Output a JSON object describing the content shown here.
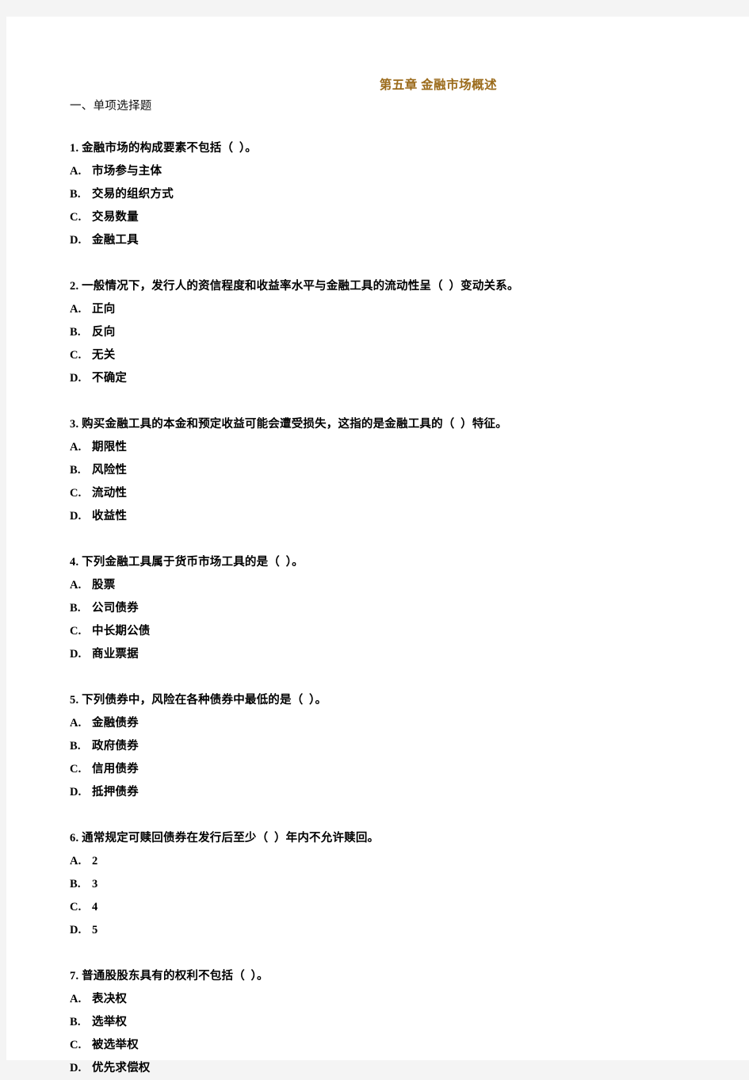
{
  "document": {
    "title": "第五章 金融市场概述",
    "section_heading": "一、单项选择题",
    "title_color": "#9b6b1b",
    "text_color": "#000000",
    "page_background": "#ffffff",
    "canvas_background": "#f4f4f4"
  },
  "questions": [
    {
      "number": "1.",
      "stem": "1. 金融市场的构成要素不包括（  ）。",
      "options": [
        {
          "letter": "A.",
          "text": "市场参与主体"
        },
        {
          "letter": "B.",
          "text": "交易的组织方式"
        },
        {
          "letter": "C.",
          "text": "交易数量"
        },
        {
          "letter": "D.",
          "text": "金融工具"
        }
      ]
    },
    {
      "number": "2.",
      "stem": "2. 一般情况下，发行人的资信程度和收益率水平与金融工具的流动性呈（  ）变动关系。",
      "options": [
        {
          "letter": "A.",
          "text": "正向"
        },
        {
          "letter": "B.",
          "text": "反向"
        },
        {
          "letter": "C.",
          "text": "无关"
        },
        {
          "letter": "D.",
          "text": "不确定"
        }
      ]
    },
    {
      "number": "3.",
      "stem": "3. 购买金融工具的本金和预定收益可能会遭受损失，这指的是金融工具的（  ）特征。",
      "options": [
        {
          "letter": "A.",
          "text": "期限性"
        },
        {
          "letter": "B.",
          "text": "风险性"
        },
        {
          "letter": "C.",
          "text": "流动性"
        },
        {
          "letter": "D.",
          "text": "收益性"
        }
      ]
    },
    {
      "number": "4.",
      "stem": "4. 下列金融工具属于货币市场工具的是（  ）。",
      "options": [
        {
          "letter": "A.",
          "text": "股票"
        },
        {
          "letter": "B.",
          "text": "公司债券"
        },
        {
          "letter": "C.",
          "text": "中长期公债"
        },
        {
          "letter": "D.",
          "text": "商业票据"
        }
      ]
    },
    {
      "number": "5.",
      "stem": "5. 下列债券中，风险在各种债券中最低的是（  ）。",
      "options": [
        {
          "letter": "A.",
          "text": "金融债券"
        },
        {
          "letter": "B.",
          "text": "政府债券"
        },
        {
          "letter": "C.",
          "text": "信用债券"
        },
        {
          "letter": "D.",
          "text": "抵押债券"
        }
      ]
    },
    {
      "number": "6.",
      "stem": "6. 通常规定可赎回债券在发行后至少（  ）年内不允许赎回。",
      "options": [
        {
          "letter": "A.",
          "text": "2"
        },
        {
          "letter": "B.",
          "text": "3"
        },
        {
          "letter": "C.",
          "text": "4"
        },
        {
          "letter": "D.",
          "text": "5"
        }
      ]
    },
    {
      "number": "7.",
      "stem": "7. 普通股股东具有的权利不包括（  ）。",
      "options": [
        {
          "letter": "A.",
          "text": "表决权"
        },
        {
          "letter": "B.",
          "text": "选举权"
        },
        {
          "letter": "C.",
          "text": "被选举权"
        },
        {
          "letter": "D.",
          "text": "优先求偿权"
        }
      ]
    }
  ]
}
